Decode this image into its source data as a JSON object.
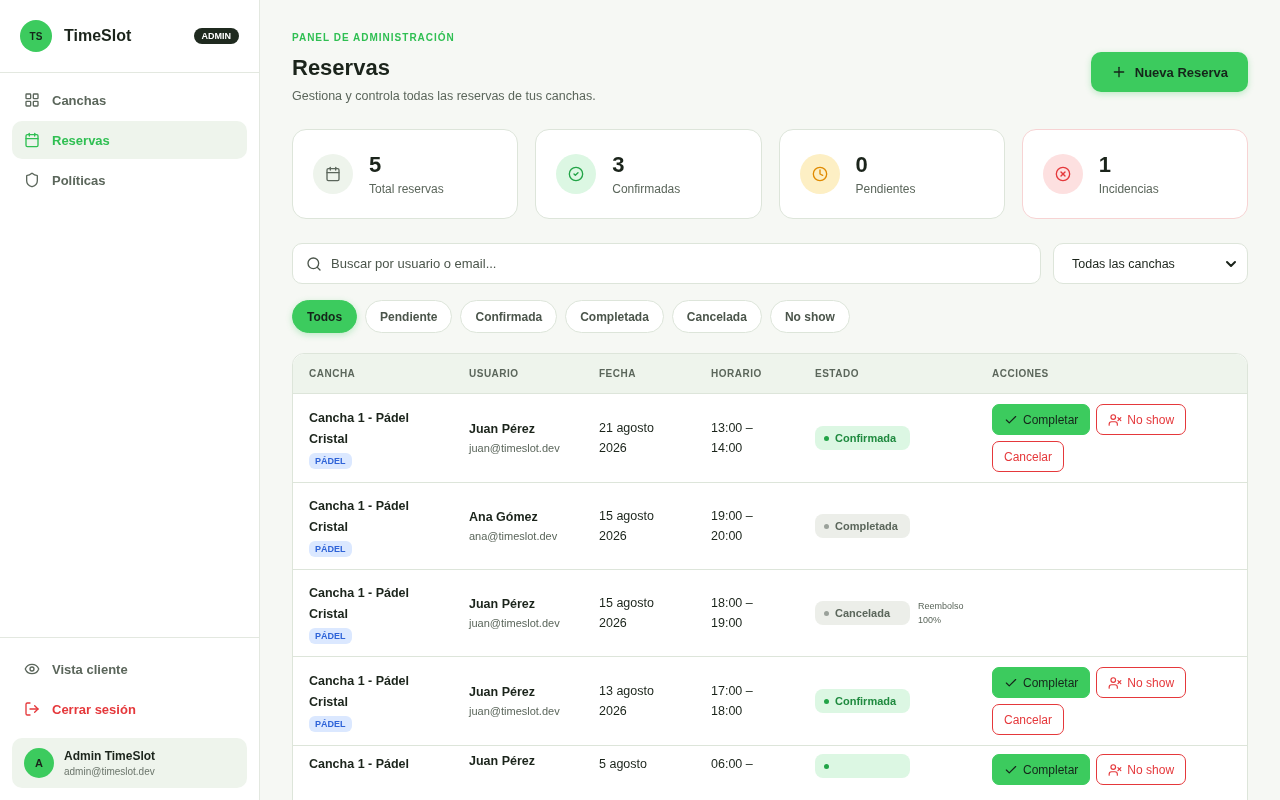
{
  "sidebar": {
    "logo": "TS",
    "brand": "TimeSlot",
    "badge": "ADMIN",
    "items": [
      {
        "label": "Canchas",
        "selected": false
      },
      {
        "label": "Reservas",
        "selected": true
      },
      {
        "label": "Políticas",
        "selected": false
      }
    ],
    "footer_links": [
      {
        "label": "Vista cliente",
        "kind": "normal"
      },
      {
        "label": "Cerrar sesión",
        "kind": "danger"
      }
    ],
    "user": {
      "avatar": "A",
      "name": "Admin TimeSlot",
      "email": "admin@timeslot.dev"
    }
  },
  "header": {
    "eyebrow": "PANEL DE ADMINISTRACIÓN",
    "title": "Reservas",
    "subtitle": "Gestiona y controla todas las reservas de tus canchas.",
    "new_button": "Nueva Reserva"
  },
  "stats": [
    {
      "value": "5",
      "label": "Total reservas",
      "kind": "total"
    },
    {
      "value": "3",
      "label": "Confirmadas",
      "kind": "ok"
    },
    {
      "value": "0",
      "label": "Pendientes",
      "kind": "pending"
    },
    {
      "value": "1",
      "label": "Incidencias",
      "kind": "issue"
    }
  ],
  "search": {
    "placeholder": "Buscar por usuario o email..."
  },
  "court_filter": {
    "value": "Todas las canchas"
  },
  "filters": [
    {
      "label": "Todos",
      "selected": true
    },
    {
      "label": "Pendiente",
      "selected": false
    },
    {
      "label": "Confirmada",
      "selected": false
    },
    {
      "label": "Completada",
      "selected": false
    },
    {
      "label": "Cancelada",
      "selected": false
    },
    {
      "label": "No show",
      "selected": false
    }
  ],
  "table": {
    "columns": [
      "CANCHA",
      "USUARIO",
      "FECHA",
      "HORARIO",
      "ESTADO",
      "ACCIONES"
    ],
    "rows": [
      {
        "court": "Cancha 1 - Pádel Cristal",
        "tag": "PÁDEL",
        "user": "Juan Pérez",
        "email": "juan@timeslot.dev",
        "date": "21 agosto 2026",
        "time": "13:00 – 14:00",
        "status": {
          "kind": "confirmed",
          "label": "Confirmada"
        },
        "actions": [
          "Completar",
          "No show",
          "Cancelar"
        ]
      },
      {
        "court": "Cancha 1 - Pádel Cristal",
        "tag": "PÁDEL",
        "user": "Ana Gómez",
        "email": "ana@timeslot.dev",
        "date": "15 agosto 2026",
        "time": "19:00 – 20:00",
        "status": {
          "kind": "done",
          "label": "Completada"
        }
      },
      {
        "court": "Cancha 1 - Pádel Cristal",
        "tag": "PÁDEL",
        "user": "Juan Pérez",
        "email": "juan@timeslot.dev",
        "date": "15 agosto 2026",
        "time": "18:00 – 19:00",
        "status": {
          "kind": "cancelled",
          "label": "Cancelada",
          "note": "Reembolso 100%"
        }
      },
      {
        "court": "Cancha 1 - Pádel Cristal",
        "tag": "PÁDEL",
        "user": "Juan Pérez",
        "email": "juan@timeslot.dev",
        "date": "13 agosto 2026",
        "time": "17:00 – 18:00",
        "status": {
          "kind": "confirmed",
          "label": "Confirmada"
        },
        "actions": [
          "Completar",
          "No show",
          "Cancelar"
        ]
      },
      {
        "court": "Cancha 1 - Pádel",
        "user": "Juan Pérez",
        "date": "5 agosto",
        "time": "06:00 –",
        "status": {
          "kind": "confirmed"
        },
        "actions": [
          "Completar",
          "No show"
        ]
      }
    ]
  }
}
